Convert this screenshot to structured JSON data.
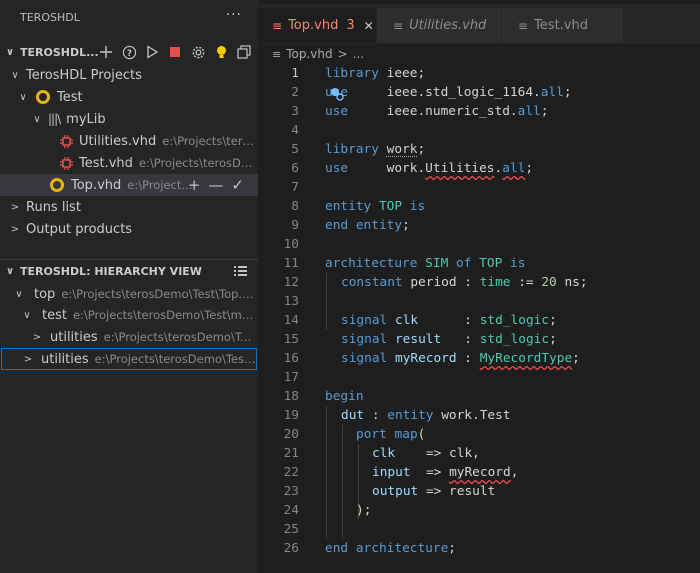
{
  "sidebar": {
    "title": "TEROSHDL",
    "more_label": "···",
    "project_section": {
      "title": "TEROSHDL...",
      "chevron": "∨"
    },
    "tree": {
      "root_label": "TerosHDL Projects",
      "project_label": "Test",
      "lib_label": "myLib",
      "files": [
        {
          "name": "Utilities.vhd",
          "path": "e:\\Projects\\teros..."
        },
        {
          "name": "Test.vhd",
          "path": "e:\\Projects\\terosDe..."
        }
      ],
      "top_file": {
        "name": "Top.vhd",
        "path": "e:\\Project..."
      },
      "runs_label": "Runs list",
      "outputs_label": "Output products"
    },
    "hierarchy_section": {
      "title": "TEROSHDL: HIERARCHY VIEW"
    },
    "hierarchy": [
      {
        "name": "top",
        "path": "e:\\Projects\\terosDemo\\Test\\Top.vhd"
      },
      {
        "name": "test",
        "path": "e:\\Projects\\terosDemo\\Test\\myL..."
      },
      {
        "name": "utilities",
        "path": "e:\\Projects\\terosDemo\\Tes..."
      },
      {
        "name": "utilities",
        "path": "e:\\Projects\\terosDemo\\Test\\..."
      }
    ]
  },
  "editor": {
    "tabs": [
      {
        "name": "Top.vhd",
        "badge": "3",
        "close": "✕"
      },
      {
        "name": "Utilities.vhd"
      },
      {
        "name": "Test.vhd"
      }
    ],
    "breadcrumb": {
      "file": "Top.vhd",
      "sep": ">",
      "rest": "..."
    },
    "line_numbers": [
      "1",
      "2",
      "3",
      "4",
      "5",
      "6",
      "7",
      "8",
      "9",
      "10",
      "11",
      "12",
      "13",
      "14",
      "15",
      "16",
      "17",
      "18",
      "19",
      "20",
      "21",
      "22",
      "23",
      "24",
      "25",
      "26"
    ],
    "code": {
      "l1": [
        "library",
        " ieee;"
      ],
      "l2": [
        "use",
        "     ieee.std_logic_1164.",
        "all",
        ";"
      ],
      "l3": [
        "use",
        "     ieee.numeric_std.",
        "all",
        ";"
      ],
      "l5": [
        "library",
        " ",
        "work",
        ";"
      ],
      "l6": [
        "use",
        "     work.",
        "Utilities",
        ".",
        "all",
        ";"
      ],
      "l8": [
        "entity",
        " ",
        "TOP",
        " ",
        "is"
      ],
      "l9": [
        "end",
        " ",
        "entity",
        ";"
      ],
      "l11": [
        "architecture",
        " ",
        "SIM",
        " ",
        "of",
        " ",
        "TOP",
        " ",
        "is"
      ],
      "l12": [
        "constant",
        " period : ",
        "time",
        " := ",
        "20",
        " ns;"
      ],
      "l14": [
        "signal",
        " ",
        "clk",
        "      : ",
        "std_logic",
        ";"
      ],
      "l15": [
        "signal",
        " ",
        "result",
        "   : ",
        "std_logic",
        ";"
      ],
      "l16": [
        "signal",
        " ",
        "myRecord",
        " : ",
        "MyRecordType",
        ";"
      ],
      "l18": [
        "begin"
      ],
      "l19": [
        "dut",
        " : ",
        "entity",
        " work.Test"
      ],
      "l20": [
        "port",
        " ",
        "map",
        "("
      ],
      "l21": [
        "clk",
        "    => clk,"
      ],
      "l22": [
        "input",
        "  => ",
        "myRecord",
        ","
      ],
      "l23": [
        "output",
        " => result"
      ],
      "l24": [
        ");"
      ],
      "l26": [
        "end",
        " ",
        "architecture",
        ";"
      ]
    }
  },
  "colors": {
    "keyword": "#569cd6",
    "type": "#4ec9b0",
    "number": "#b5cea8",
    "variable": "#9cdcfe",
    "error_badge": "#f48771",
    "active_tab_text": "#f48771",
    "project_icon": "#e7b416",
    "selection_border": "#0e70c0"
  }
}
